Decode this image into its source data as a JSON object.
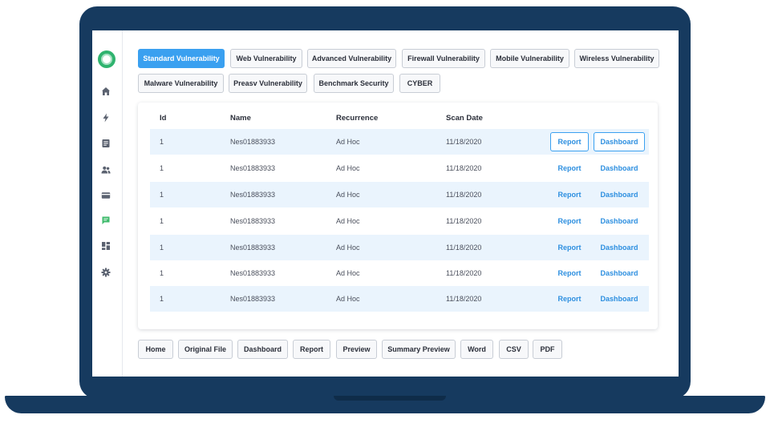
{
  "colors": {
    "accent": "#3aa0f0",
    "frame": "#163a5f",
    "logo": "#2fb36e",
    "stripe": "#eaf4fd"
  },
  "sidebar": {
    "icons": [
      "home-icon",
      "bolt-icon",
      "document-icon",
      "users-icon",
      "card-icon",
      "chat-icon",
      "widgets-icon",
      "gear-icon"
    ]
  },
  "tabs": [
    {
      "label": "Standard Vulnerability",
      "active": true
    },
    {
      "label": "Web Vulnerability"
    },
    {
      "label": "Advanced Vulnerability"
    },
    {
      "label": "Firewall Vulnerability"
    },
    {
      "label": "Mobile Vulnerability"
    },
    {
      "label": "Wireless Vulnerability"
    },
    {
      "label": "Malware Vulnerability"
    },
    {
      "label": "Preasv Vulnerability"
    },
    {
      "label": "Benchmark Security"
    },
    {
      "label": "CYBER"
    }
  ],
  "table": {
    "headers": {
      "id": "Id",
      "name": "Name",
      "recurrence": "Recurrence",
      "scan_date": "Scan Date"
    },
    "rows": [
      {
        "id": "1",
        "name": "Nes01883933",
        "recurrence": "Ad Hoc",
        "scan_date": "11/18/2020",
        "report": "Report",
        "dashboard": "Dashboard"
      },
      {
        "id": "1",
        "name": "Nes01883933",
        "recurrence": "Ad Hoc",
        "scan_date": "11/18/2020",
        "report": "Report",
        "dashboard": "Dashboard"
      },
      {
        "id": "1",
        "name": "Nes01883933",
        "recurrence": "Ad Hoc",
        "scan_date": "11/18/2020",
        "report": "Report",
        "dashboard": "Dashboard"
      },
      {
        "id": "1",
        "name": "Nes01883933",
        "recurrence": "Ad Hoc",
        "scan_date": "11/18/2020",
        "report": "Report",
        "dashboard": "Dashboard"
      },
      {
        "id": "1",
        "name": "Nes01883933",
        "recurrence": "Ad Hoc",
        "scan_date": "11/18/2020",
        "report": "Report",
        "dashboard": "Dashboard"
      },
      {
        "id": "1",
        "name": "Nes01883933",
        "recurrence": "Ad Hoc",
        "scan_date": "11/18/2020",
        "report": "Report",
        "dashboard": "Dashboard"
      },
      {
        "id": "1",
        "name": "Nes01883933",
        "recurrence": "Ad Hoc",
        "scan_date": "11/18/2020",
        "report": "Report",
        "dashboard": "Dashboard"
      }
    ]
  },
  "bottom_buttons": [
    "Home",
    "Original File",
    "Dashboard",
    "Report",
    "Preview",
    "Summary Preview",
    "Word",
    "CSV",
    "PDF"
  ]
}
